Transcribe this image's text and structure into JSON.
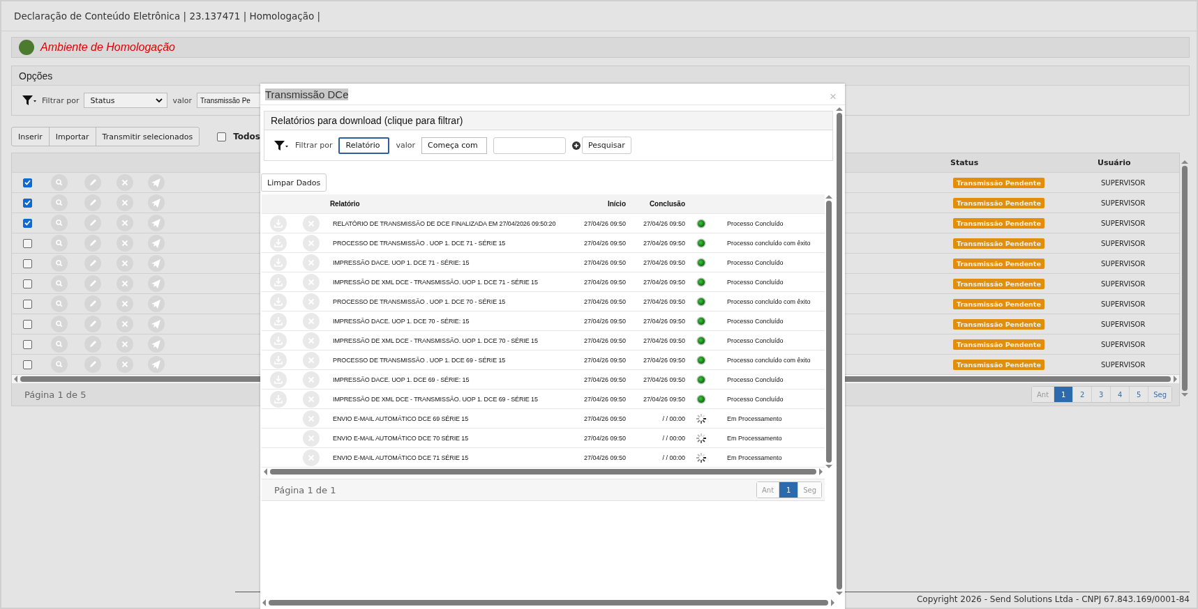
{
  "header": {
    "title": "Declaração de Conteúdo Eletrônica | 23.137471 | Homologação |"
  },
  "environment": {
    "label": "Ambiente de Homologação"
  },
  "options": {
    "title": "Opções",
    "filter_label": "Filtrar por",
    "filter_field": "Status",
    "value_label": "valor",
    "value_field": "Transmissão Pe"
  },
  "toolbar": {
    "buttons": [
      "Inserir",
      "Importar",
      "Transmitir selecionados"
    ],
    "select_all": {
      "label": "Todos",
      "checked": false
    }
  },
  "table": {
    "columns": [
      "Status",
      "Usuário"
    ],
    "rows": [
      {
        "checked": true,
        "status": "Transmissão Pendente",
        "user": "SUPERVISOR"
      },
      {
        "checked": true,
        "status": "Transmissão Pendente",
        "user": "SUPERVISOR"
      },
      {
        "checked": true,
        "status": "Transmissão Pendente",
        "user": "SUPERVISOR"
      },
      {
        "checked": false,
        "status": "Transmissão Pendente",
        "user": "SUPERVISOR"
      },
      {
        "checked": false,
        "status": "Transmissão Pendente",
        "user": "SUPERVISOR"
      },
      {
        "checked": false,
        "status": "Transmissão Pendente",
        "user": "SUPERVISOR"
      },
      {
        "checked": false,
        "status": "Transmissão Pendente",
        "user": "SUPERVISOR"
      },
      {
        "checked": false,
        "status": "Transmissão Pendente",
        "user": "SUPERVISOR"
      },
      {
        "checked": false,
        "status": "Transmissão Pendente",
        "user": "SUPERVISOR"
      },
      {
        "checked": false,
        "status": "Transmissão Pendente",
        "user": "SUPERVISOR"
      }
    ]
  },
  "pagination": {
    "label": "Página 1 de 5",
    "pages": [
      {
        "label": "Ant",
        "selected": false,
        "disabled": true
      },
      {
        "label": "1",
        "selected": true,
        "disabled": false
      },
      {
        "label": "2",
        "selected": false,
        "disabled": false
      },
      {
        "label": "3",
        "selected": false,
        "disabled": false
      },
      {
        "label": "4",
        "selected": false,
        "disabled": false
      },
      {
        "label": "5",
        "selected": false,
        "disabled": false
      },
      {
        "label": "Seg",
        "selected": false,
        "disabled": false
      }
    ]
  },
  "footer": {
    "copyright": "Copyright 2026 - Send Solutions Ltda - CNPJ 67.843.169/0001-84"
  },
  "modal": {
    "title": "Transmissão DCe",
    "close": "×",
    "panel": {
      "title": "Relatórios para download (clique para filtrar)",
      "filter_label": "Filtrar por",
      "filter_field": "Relatório",
      "value_label": "valor",
      "value_operator": "Começa com",
      "search_button": "Pesquisar"
    },
    "clear_button": "Limpar Dados",
    "table": {
      "columns": [
        "Relatório",
        "Início",
        "Conclusão"
      ],
      "rows": [
        {
          "kind": "done",
          "report": "RELATÓRIO DE TRANSMISSÃO DE DCE FINALIZADA EM 27/04/2026 09:50:20",
          "start": "27/04/26 09:50",
          "end": "27/04/26 09:50",
          "status": "Processo Concluído"
        },
        {
          "kind": "done",
          "report": "PROCESSO DE TRANSMISSÃO . UOP 1. DCE 71 - SÉRIE 15",
          "start": "27/04/26 09:50",
          "end": "27/04/26 09:50",
          "status": "Processo concluído com êxito"
        },
        {
          "kind": "done",
          "report": "IMPRESSÃO DACE. UOP 1. DCE 71 - SÉRIE: 15",
          "start": "27/04/26 09:50",
          "end": "27/04/26 09:50",
          "status": "Processo Concluído"
        },
        {
          "kind": "done",
          "report": "IMPRESSÃO DE XML DCE - TRANSMISSÃO. UOP 1. DCE 71 - SÉRIE 15",
          "start": "27/04/26 09:50",
          "end": "27/04/26 09:50",
          "status": "Processo Concluído"
        },
        {
          "kind": "done",
          "report": "PROCESSO DE TRANSMISSÃO . UOP 1. DCE 70 - SÉRIE 15",
          "start": "27/04/26 09:50",
          "end": "27/04/26 09:50",
          "status": "Processo concluído com êxito"
        },
        {
          "kind": "done",
          "report": "IMPRESSÃO DACE. UOP 1. DCE 70 - SÉRIE: 15",
          "start": "27/04/26 09:50",
          "end": "27/04/26 09:50",
          "status": "Processo Concluído"
        },
        {
          "kind": "done",
          "report": "IMPRESSÃO DE XML DCE - TRANSMISSÃO. UOP 1. DCE 70 - SÉRIE 15",
          "start": "27/04/26 09:50",
          "end": "27/04/26 09:50",
          "status": "Processo Concluído"
        },
        {
          "kind": "done",
          "report": "PROCESSO DE TRANSMISSÃO . UOP 1. DCE 69 - SÉRIE 15",
          "start": "27/04/26 09:50",
          "end": "27/04/26 09:50",
          "status": "Processo concluído com êxito"
        },
        {
          "kind": "done",
          "report": "IMPRESSÃO DACE. UOP 1. DCE 69 - SÉRIE: 15",
          "start": "27/04/26 09:50",
          "end": "27/04/26 09:50",
          "status": "Processo Concluído"
        },
        {
          "kind": "done",
          "report": "IMPRESSÃO DE XML DCE - TRANSMISSÃO. UOP 1. DCE 69 - SÉRIE 15",
          "start": "27/04/26 09:50",
          "end": "27/04/26 09:50",
          "status": "Processo Concluído"
        },
        {
          "kind": "processing",
          "report": "ENVIO E-MAIL AUTOMÁTICO DCE 69 SÉRIE 15",
          "start": "27/04/26 09:50",
          "end": "/ / 00:00",
          "status": "Em Processamento"
        },
        {
          "kind": "processing",
          "report": "ENVIO E-MAIL AUTOMÁTICO DCE 70 SÉRIE 15",
          "start": "27/04/26 09:50",
          "end": "/ / 00:00",
          "status": "Em Processamento"
        },
        {
          "kind": "processing",
          "report": "ENVIO E-MAIL AUTOMÁTICO DCE 71 SÉRIE 15",
          "start": "27/04/26 09:50",
          "end": "/ / 00:00",
          "status": "Em Processamento"
        }
      ]
    },
    "pagination": {
      "label": "Página 1 de 1",
      "pages": [
        {
          "label": "Ant",
          "selected": false,
          "disabled": true
        },
        {
          "label": "1",
          "selected": true,
          "disabled": false
        },
        {
          "label": "Seg",
          "selected": false,
          "disabled": true
        }
      ]
    }
  }
}
